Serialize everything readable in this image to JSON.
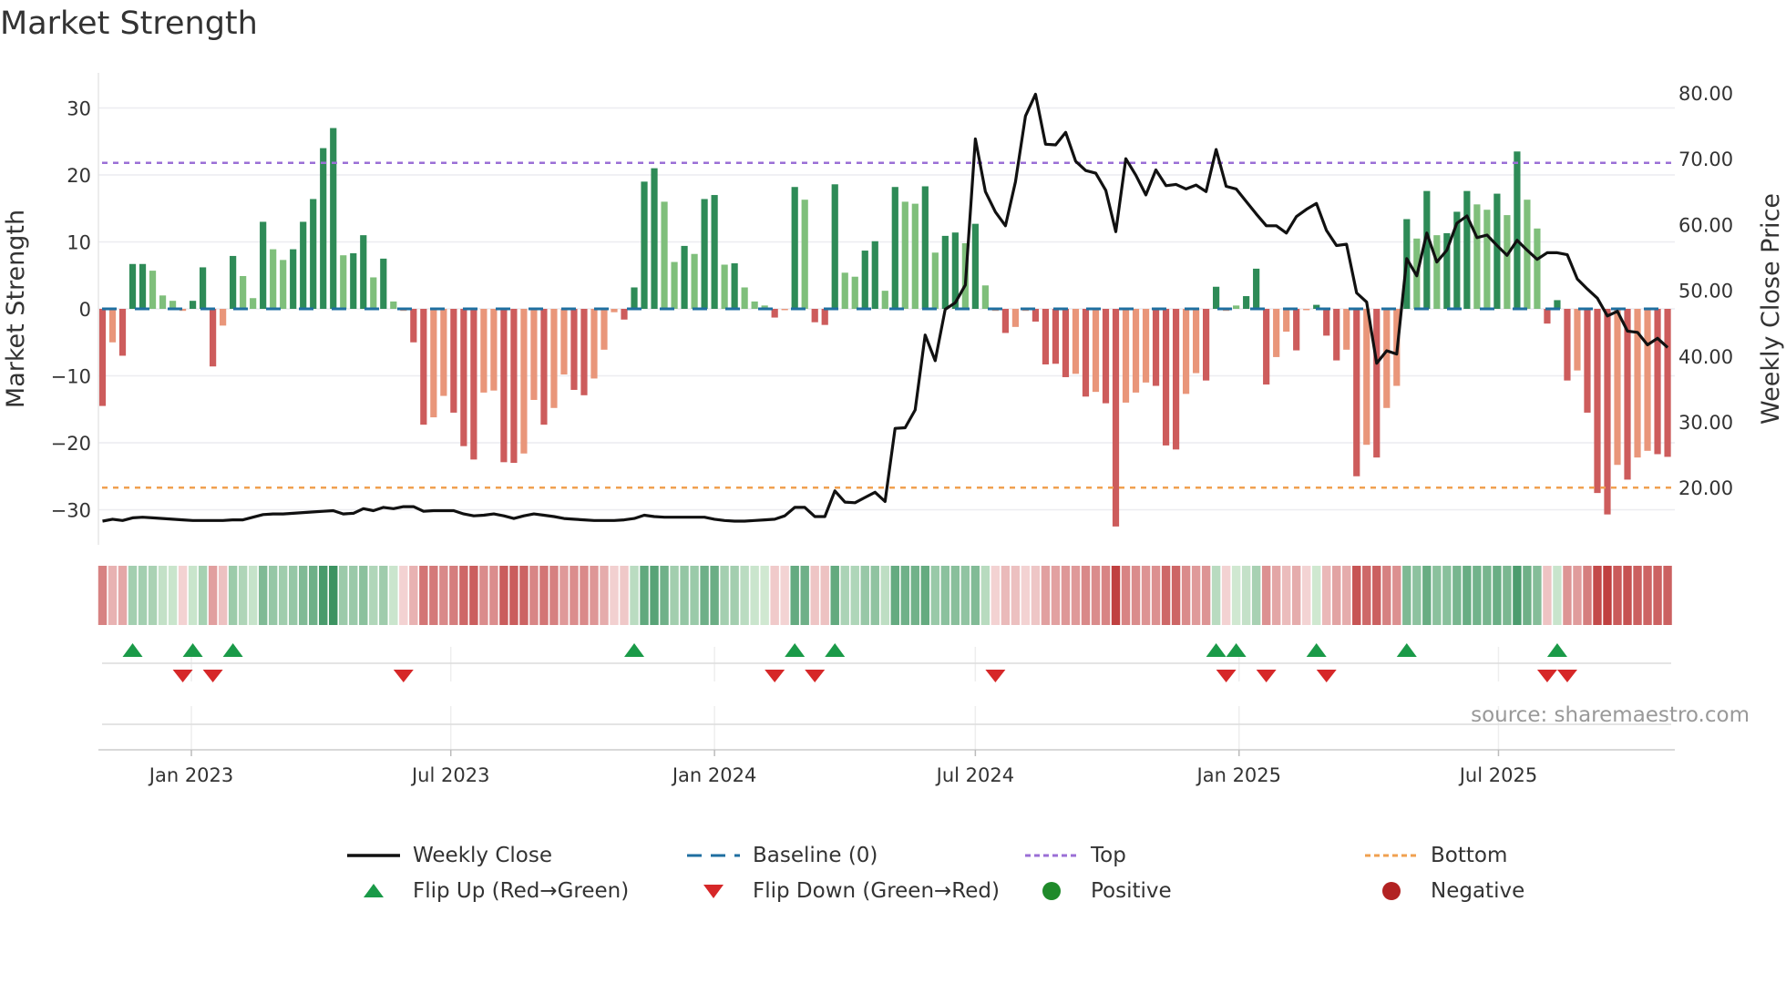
{
  "title": "Market Strength",
  "source": "source: sharemaestro.com",
  "legend": {
    "weekly_close": "Weekly Close",
    "baseline": "Baseline (0)",
    "top": "Top",
    "bottom": "Bottom",
    "flip_up": "Flip Up (Red→Green)",
    "flip_down": "Flip Down (Green→Red)",
    "positive": "Positive",
    "negative": "Negative"
  },
  "colors": {
    "pos_dark": "#2e8b57",
    "pos_light": "#7fbf7b",
    "neg_dark": "#cd5c5c",
    "neg_light": "#e9967a",
    "line": "#111111",
    "baseline": "#1f6fa0",
    "top": "#9b6fd6",
    "bottom": "#f0a050",
    "flip_up": "#1a9a48",
    "flip_down": "#d62728",
    "positive_dot": "#1f8a2a",
    "negative_dot": "#b22222"
  },
  "chart_data": {
    "type": "bar",
    "title": "Market Strength",
    "ylabel": "Market Strength",
    "y2label": "Weekly Close Price",
    "ylim": [
      -35,
      35
    ],
    "y2lim": [
      13,
      83
    ],
    "yticks": [
      "30",
      "20",
      "10",
      "0",
      "−10",
      "−20",
      "−30"
    ],
    "ytick_values": [
      30,
      20,
      10,
      0,
      -10,
      -20,
      -30
    ],
    "y2ticks": [
      "80.00",
      "70.00",
      "60.00",
      "50.00",
      "40.00",
      "30.00",
      "20.00"
    ],
    "y2tick_values": [
      80,
      70,
      60,
      50,
      40,
      30,
      20
    ],
    "xticks": [
      "Jan 2023",
      "Jul 2023",
      "Jan 2024",
      "Jul 2024",
      "Jan 2025",
      "Jul 2025"
    ],
    "xtick_dates": [
      "2023-01-01",
      "2023-07-01",
      "2024-01-01",
      "2024-07-01",
      "2025-01-01",
      "2025-07-01"
    ],
    "start_week": "2022-10-31",
    "interval": "weekly",
    "top_threshold": 21.8,
    "bottom_threshold": -26.7,
    "baseline": 0,
    "strength": [
      -14.5,
      -5,
      -7,
      6.7,
      6.7,
      5.7,
      2,
      1.2,
      -0.3,
      1.2,
      6.2,
      -8.6,
      -2.5,
      7.9,
      4.9,
      1.6,
      13,
      8.9,
      7.3,
      8.9,
      13,
      16.4,
      24,
      27,
      8,
      8.3,
      11,
      4.7,
      7.5,
      1.1,
      -0.3,
      -5,
      -17.3,
      -16.2,
      -13,
      -15.5,
      -20.5,
      -22.5,
      -12.5,
      -12.2,
      -22.9,
      -23,
      -21.6,
      -13.6,
      -17.3,
      -14.8,
      -9.8,
      -12.1,
      -12.9,
      -10.4,
      -6.1,
      -0.5,
      -1.6,
      3.2,
      19,
      21,
      16,
      7,
      9.4,
      8.2,
      16.4,
      17,
      6.6,
      6.8,
      3.2,
      1.1,
      0.5,
      -1.3,
      -0.2,
      18.2,
      16.3,
      -2,
      -2.4,
      18.6,
      5.4,
      4.8,
      8.7,
      10.1,
      2.7,
      18.2,
      16,
      15.7,
      18.3,
      8.4,
      10.9,
      11.4,
      9.8,
      12.7,
      3.5,
      -0.3,
      -3.6,
      -2.7,
      -0.3,
      -1.9,
      -8.3,
      -8.2,
      -10.2,
      -9.7,
      -13.1,
      -12.4,
      -14.1,
      -32.5,
      -14,
      -12.5,
      -11,
      -11.5,
      -20.4,
      -21,
      -12.7,
      -9.6,
      -10.7,
      3.3,
      -0.3,
      0.5,
      1.9,
      6,
      -11.3,
      -7.2,
      -3.4,
      -6.2,
      -0.2,
      0.6,
      -4,
      -7.7,
      -6.1,
      -25,
      -20.3,
      -22.2,
      -14.8,
      -11.5,
      13.4,
      10.5,
      17.6,
      11,
      11.3,
      14.5,
      17.6,
      15.6,
      14.8,
      17.2,
      14,
      23.5,
      16.3,
      12,
      -2.2,
      1.3,
      -10.7,
      -9.2,
      -15.5,
      -27.5,
      -30.7,
      -23.3,
      -25.5,
      -22.2,
      -21.2,
      -21.7,
      -22.1
    ],
    "tones": "DLDDDLLLLDDDLDLLDLLDDDDDLDDLDLLDDLLDDDLLDDLLDLLDDLLLDDDDLLDLDDLDLLLDLDLDDDLLDDLDLLDLDDLDLLDLLDDDDLDLDDLLLDDDLLDDLLDDDLLDLDDDLDLDLLDLDLDDDLLDLDLLDDDLDDDLDLLDD",
    "weekly_close": [
      14.9,
      15.2,
      15.0,
      15.4,
      15.5,
      15.4,
      15.3,
      15.2,
      15.1,
      15.0,
      15.0,
      15.0,
      15.0,
      15.1,
      15.1,
      15.5,
      15.9,
      16.0,
      16.0,
      16.1,
      16.2,
      16.3,
      16.4,
      16.5,
      16.0,
      16.1,
      16.8,
      16.5,
      17.0,
      16.8,
      17.1,
      17.1,
      16.4,
      16.5,
      16.5,
      16.5,
      16.0,
      15.7,
      15.8,
      16.0,
      15.7,
      15.3,
      15.7,
      16.0,
      15.8,
      15.6,
      15.3,
      15.2,
      15.1,
      15.0,
      15.0,
      15.0,
      15.1,
      15.3,
      15.8,
      15.6,
      15.5,
      15.5,
      15.5,
      15.5,
      15.5,
      15.2,
      15.0,
      14.9,
      14.9,
      15.0,
      15.1,
      15.2,
      15.7,
      17.0,
      17.0,
      15.6,
      15.6,
      19.5,
      17.8,
      17.7,
      18.5,
      19.3,
      17.9,
      29.0,
      29.1,
      31.8,
      43.2,
      39.3,
      47.1,
      48.1,
      50.8,
      73.0,
      65.0,
      61.9,
      59.8,
      66.5,
      76.5,
      79.8,
      72.2,
      72.1,
      74.0,
      69.6,
      68.2,
      67.8,
      65.2,
      58.9,
      70.0,
      67.5,
      64.5,
      68.3,
      65.9,
      66.1,
      65.4,
      66.0,
      65.0,
      71.4,
      65.8,
      65.4,
      63.5,
      61.6,
      59.8,
      59.8,
      58.7,
      61.2,
      62.3,
      63.2,
      59.1,
      56.8,
      57.0,
      49.6,
      48.2,
      38.9,
      40.8,
      40.3,
      54.8,
      52.2,
      58.7,
      54.3,
      56.1,
      60.2,
      61.3,
      58.0,
      58.4,
      56.8,
      55.3,
      57.6,
      56.1,
      54.7,
      55.7,
      55.7,
      55.4,
      51.7,
      50.2,
      48.8,
      46.1,
      46.8,
      43.8,
      43.6,
      41.7,
      42.7,
      41.3
    ],
    "flip_up_dates": [
      "2022-11-21",
      "2023-01-02",
      "2023-01-30",
      "2023-11-06",
      "2024-02-26",
      "2024-03-25",
      "2024-12-16",
      "2024-12-30",
      "2025-02-24",
      "2025-04-28",
      "2025-08-11"
    ],
    "flip_down_dates": [
      "2022-12-26",
      "2023-01-16",
      "2023-05-29",
      "2024-02-12",
      "2024-03-11",
      "2024-07-15",
      "2024-12-23",
      "2025-01-20",
      "2025-03-03",
      "2025-08-04",
      "2025-08-18"
    ],
    "legend_position": "bottom-center"
  }
}
